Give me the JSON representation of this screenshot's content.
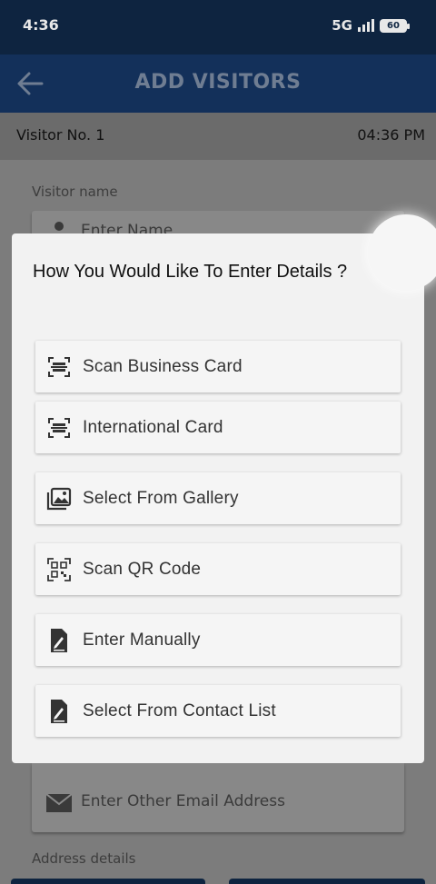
{
  "status": {
    "time": "4:36",
    "network": "5G",
    "battery": "60"
  },
  "header": {
    "title": "ADD VISITORS"
  },
  "visitor": {
    "number": "Visitor No. 1",
    "time": "04:36 PM"
  },
  "form": {
    "name_label": "Visitor name",
    "name_placeholder": "Enter Name",
    "email_placeholder": "Enter Other Email Address",
    "address_label": "Address details"
  },
  "dialog": {
    "title": "How You Would Like To Enter Details ?",
    "options": [
      {
        "label": "Scan Business Card",
        "icon": "scan-card-icon"
      },
      {
        "label": "International Card",
        "icon": "scan-card-icon"
      },
      {
        "label": "Select From Gallery",
        "icon": "gallery-icon"
      },
      {
        "label": "Scan QR Code",
        "icon": "qr-code-icon"
      },
      {
        "label": "Enter Manually",
        "icon": "edit-note-icon"
      },
      {
        "label": "Select From Contact List",
        "icon": "edit-note-icon"
      }
    ]
  },
  "colors": {
    "status_bar": "#0e2440",
    "app_bar": "#13305a",
    "dialog_bg": "#f2f2f2"
  }
}
